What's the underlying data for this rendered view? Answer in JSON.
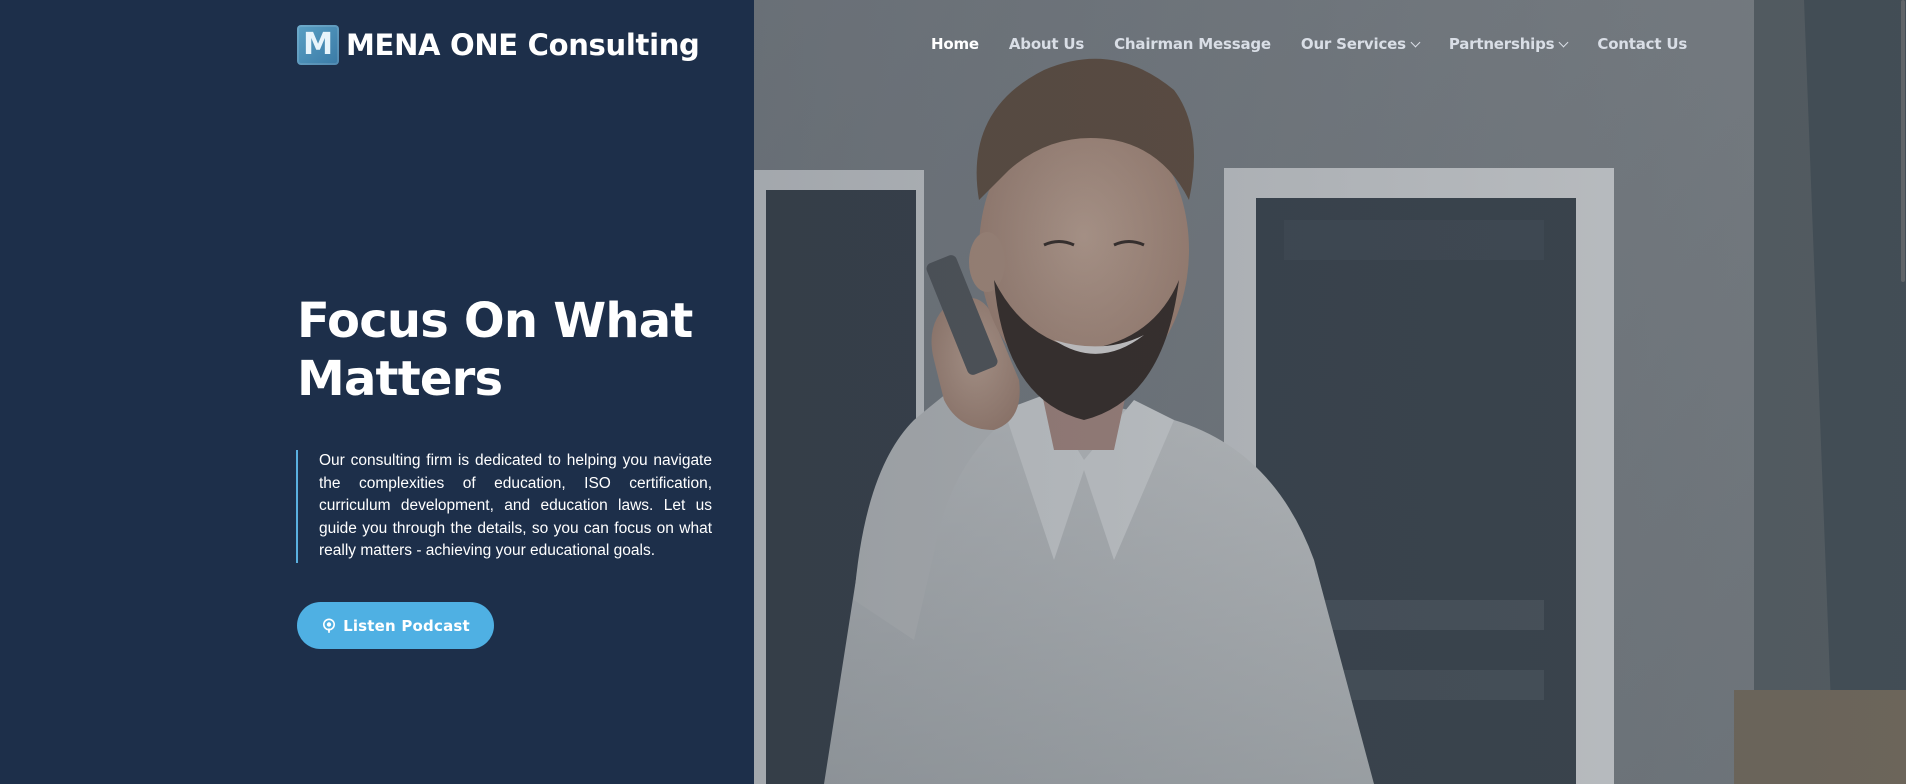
{
  "brand": {
    "logo_letter": "M",
    "name": "MENA ONE Consulting",
    "accent_color": "#4fb0e3",
    "panel_color": "#1d2f4a"
  },
  "nav": {
    "items": [
      {
        "label": "Home",
        "active": true,
        "has_dropdown": false
      },
      {
        "label": "About Us",
        "active": false,
        "has_dropdown": false
      },
      {
        "label": "Chairman Message",
        "active": false,
        "has_dropdown": false
      },
      {
        "label": "Our Services",
        "active": false,
        "has_dropdown": true
      },
      {
        "label": "Partnerships",
        "active": false,
        "has_dropdown": true
      },
      {
        "label": "Contact Us",
        "active": false,
        "has_dropdown": false
      }
    ]
  },
  "hero": {
    "title_line1": "Focus On What",
    "title_line2": "Matters",
    "description": "Our consulting firm is dedicated to helping you navigate the complexities of education, ISO certification, curriculum development, and education laws. Let us guide you through the details, so you can focus on what really matters - achieving your educational goals.",
    "cta_label": "Listen Podcast",
    "cta_icon": "podcast-icon",
    "image_subject": "smiling man talking on phone"
  }
}
